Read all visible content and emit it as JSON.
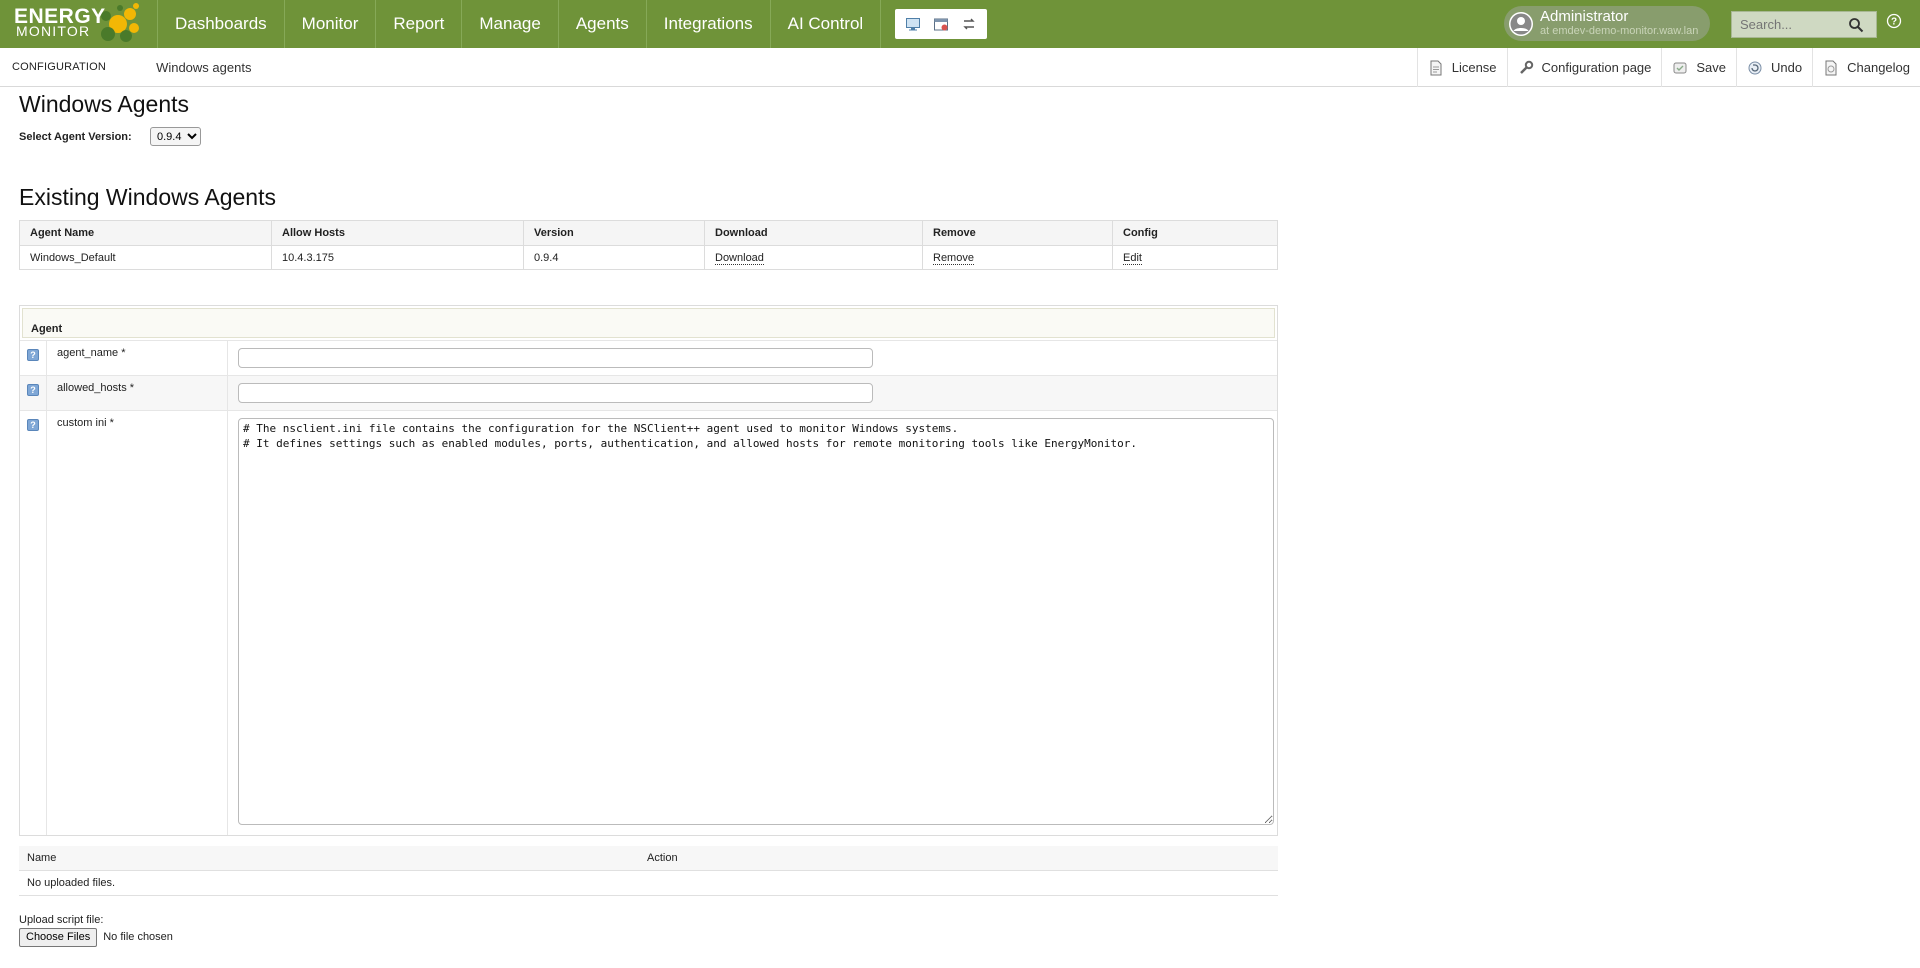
{
  "app": {
    "logo_line1": "ENERGY",
    "logo_line2": "MONITOR",
    "brand_color": "#6f9339"
  },
  "nav": {
    "items": [
      {
        "label": "Dashboards"
      },
      {
        "label": "Monitor"
      },
      {
        "label": "Report"
      },
      {
        "label": "Manage"
      },
      {
        "label": "Agents"
      },
      {
        "label": "Integrations"
      },
      {
        "label": "AI Control"
      }
    ],
    "tool_icons": [
      "monitor-icon",
      "calendar-icon",
      "switch-icon"
    ]
  },
  "user": {
    "name": "Administrator",
    "host": "at emdev-demo-monitor.waw.lan"
  },
  "search": {
    "placeholder": "Search..."
  },
  "breadcrumb": {
    "section": "CONFIGURATION",
    "page": "Windows agents"
  },
  "actions": {
    "license": "License",
    "config_page": "Configuration page",
    "save": "Save",
    "undo": "Undo",
    "changelog": "Changelog"
  },
  "main": {
    "title": "Windows Agents",
    "version_label": "Select Agent Version:",
    "version_selected": "0.9.4",
    "existing_title": "Existing Windows Agents"
  },
  "agents_table": {
    "headers": [
      "Agent Name",
      "Allow Hosts",
      "Version",
      "Download",
      "Remove",
      "Config"
    ],
    "rows": [
      {
        "name": "Windows_Default",
        "hosts": "10.4.3.175",
        "version": "0.9.4",
        "download": "Download",
        "remove": "Remove",
        "config": "Edit"
      }
    ]
  },
  "form": {
    "section_title": "Agent",
    "fields": {
      "agent_name": {
        "label": "agent_name *",
        "value": ""
      },
      "allowed_hosts": {
        "label": "allowed_hosts *",
        "value": ""
      },
      "custom_ini": {
        "label": "custom ini *",
        "value": "# The nsclient.ini file contains the configuration for the NSClient++ agent used to monitor Windows systems.\n# It defines settings such as enabled modules, ports, authentication, and allowed hosts for remote monitoring tools like EnergyMonitor."
      }
    }
  },
  "files_table": {
    "headers": [
      "Name",
      "Action"
    ],
    "empty_text": "No uploaded files."
  },
  "upload": {
    "label": "Upload script file:",
    "button": "Choose Files",
    "status": "No file chosen"
  }
}
